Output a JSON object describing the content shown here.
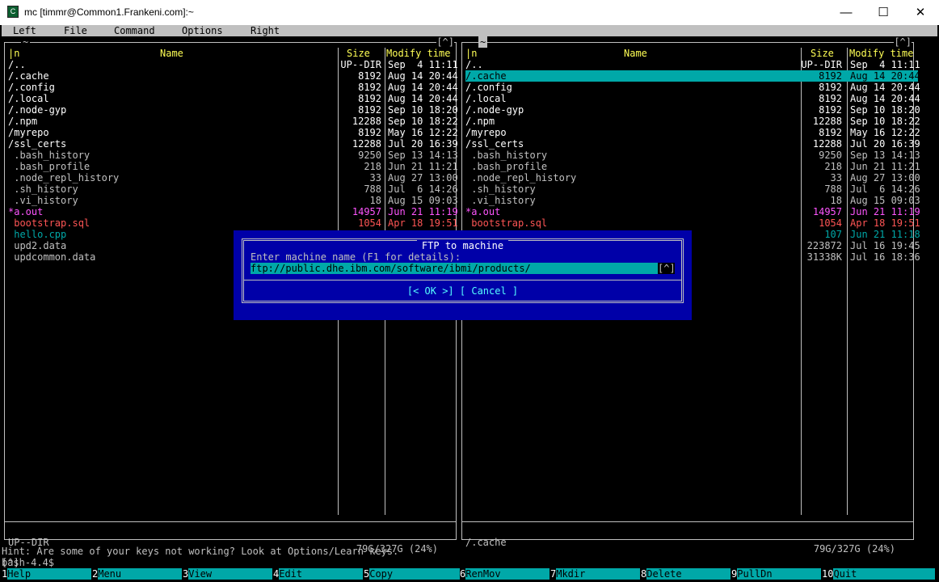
{
  "window": {
    "title": "mc [timmr@Common1.Frankeni.com]:~",
    "minimize": "—",
    "maximize": "☐",
    "close": "✕"
  },
  "menu": [
    "Left",
    "File",
    "Command",
    "Options",
    "Right"
  ],
  "panels": [
    {
      "title": "~",
      "buttons": "[^]",
      "headers": {
        "sort": "|n",
        "name": "Name",
        "size": "Size",
        "mtime": "Modify time"
      },
      "files": [
        {
          "name": "/..",
          "size": "UP--DIR",
          "mtime": "Sep  4 11:11",
          "color": "#ffffff"
        },
        {
          "name": "/.cache",
          "size": "8192",
          "mtime": "Aug 14 20:44",
          "color": "#ffffff"
        },
        {
          "name": "/.config",
          "size": "8192",
          "mtime": "Aug 14 20:44",
          "color": "#ffffff"
        },
        {
          "name": "/.local",
          "size": "8192",
          "mtime": "Aug 14 20:44",
          "color": "#ffffff"
        },
        {
          "name": "/.node-gyp",
          "size": "8192",
          "mtime": "Sep 10 18:20",
          "color": "#ffffff"
        },
        {
          "name": "/.npm",
          "size": "12288",
          "mtime": "Sep 10 18:22",
          "color": "#ffffff"
        },
        {
          "name": "/myrepo",
          "size": "8192",
          "mtime": "May 16 12:22",
          "color": "#ffffff"
        },
        {
          "name": "/ssl_certs",
          "size": "12288",
          "mtime": "Jul 20 16:39",
          "color": "#ffffff"
        },
        {
          "name": " .bash_history",
          "size": "9250",
          "mtime": "Sep 13 14:13",
          "color": "#c0c0c0"
        },
        {
          "name": " .bash_profile",
          "size": "218",
          "mtime": "Jun 21 11:21",
          "color": "#c0c0c0"
        },
        {
          "name": " .node_repl_history",
          "size": "33",
          "mtime": "Aug 27 13:00",
          "color": "#c0c0c0"
        },
        {
          "name": " .sh_history",
          "size": "788",
          "mtime": "Jul  6 14:26",
          "color": "#c0c0c0"
        },
        {
          "name": " .vi_history",
          "size": "18",
          "mtime": "Aug 15 09:03",
          "color": "#c0c0c0"
        },
        {
          "name": "*a.out",
          "size": "14957",
          "mtime": "Jun 21 11:19",
          "color": "#ff55ff"
        },
        {
          "name": " bootstrap.sql",
          "size": "1054",
          "mtime": "Apr 18 19:51",
          "color": "#ff5555"
        },
        {
          "name": " hello.cpp",
          "size": "",
          "mtime": "",
          "color": "#00a8a8"
        },
        {
          "name": " upd2.data",
          "size": "",
          "mtime": "",
          "color": "#c0c0c0"
        },
        {
          "name": " updcommon.data",
          "size": "",
          "mtime": "",
          "color": "#c0c0c0"
        }
      ],
      "status": "UP--DIR",
      "free": "79G/327G (24%)"
    },
    {
      "title": "~",
      "buttons": "[^]",
      "headers": {
        "sort": "|n",
        "name": "Name",
        "size": "Size",
        "mtime": "Modify time"
      },
      "files": [
        {
          "name": "/..",
          "size": "UP--DIR",
          "mtime": "Sep  4 11:11",
          "color": "#ffffff"
        },
        {
          "name": "/.cache",
          "size": "8192",
          "mtime": "Aug 14 20:44",
          "color": "#ffffff",
          "selected": true
        },
        {
          "name": "/.config",
          "size": "8192",
          "mtime": "Aug 14 20:44",
          "color": "#ffffff"
        },
        {
          "name": "/.local",
          "size": "8192",
          "mtime": "Aug 14 20:44",
          "color": "#ffffff"
        },
        {
          "name": "/.node-gyp",
          "size": "8192",
          "mtime": "Sep 10 18:20",
          "color": "#ffffff"
        },
        {
          "name": "/.npm",
          "size": "12288",
          "mtime": "Sep 10 18:22",
          "color": "#ffffff"
        },
        {
          "name": "/myrepo",
          "size": "8192",
          "mtime": "May 16 12:22",
          "color": "#ffffff"
        },
        {
          "name": "/ssl_certs",
          "size": "12288",
          "mtime": "Jul 20 16:39",
          "color": "#ffffff"
        },
        {
          "name": " .bash_history",
          "size": "9250",
          "mtime": "Sep 13 14:13",
          "color": "#c0c0c0"
        },
        {
          "name": " .bash_profile",
          "size": "218",
          "mtime": "Jun 21 11:21",
          "color": "#c0c0c0"
        },
        {
          "name": " .node_repl_history",
          "size": "33",
          "mtime": "Aug 27 13:00",
          "color": "#c0c0c0"
        },
        {
          "name": " .sh_history",
          "size": "788",
          "mtime": "Jul  6 14:26",
          "color": "#c0c0c0"
        },
        {
          "name": " .vi_history",
          "size": "18",
          "mtime": "Aug 15 09:03",
          "color": "#c0c0c0"
        },
        {
          "name": "*a.out",
          "size": "14957",
          "mtime": "Jun 21 11:19",
          "color": "#ff55ff"
        },
        {
          "name": " bootstrap.sql",
          "size": "1054",
          "mtime": "Apr 18 19:51",
          "color": "#ff5555"
        },
        {
          "name": "",
          "size": "107",
          "mtime": "Jun 21 11:18",
          "color": "#00a8a8"
        },
        {
          "name": "",
          "size": "223872",
          "mtime": "Jul 16 19:45",
          "color": "#c0c0c0"
        },
        {
          "name": "",
          "size": "31338K",
          "mtime": "Jul 16 18:36",
          "color": "#c0c0c0"
        }
      ],
      "status": "/.cache",
      "free": "79G/327G (24%)"
    }
  ],
  "dialog": {
    "title": "FTP to machine",
    "label": "Enter machine name (F1 for details):",
    "value": "ftp://public.dhe.ibm.com/software/ibmi/products/",
    "history_button": "[^]",
    "ok": "[< OK >]",
    "cancel": "[ Cancel ]"
  },
  "hint": "Hint: Are some of your keys not working? Look at Options/Learn keys.",
  "prompt": "bash-4.4$",
  "cmd_history_button": "[^]",
  "fkeys": [
    {
      "num": "1",
      "label": "Help"
    },
    {
      "num": "2",
      "label": "Menu"
    },
    {
      "num": "3",
      "label": "View"
    },
    {
      "num": "4",
      "label": "Edit"
    },
    {
      "num": "5",
      "label": "Copy"
    },
    {
      "num": "6",
      "label": "RenMov"
    },
    {
      "num": "7",
      "label": "Mkdir"
    },
    {
      "num": "8",
      "label": "Delete"
    },
    {
      "num": "9",
      "label": "PullDn"
    },
    {
      "num": "10",
      "label": "Quit"
    }
  ]
}
